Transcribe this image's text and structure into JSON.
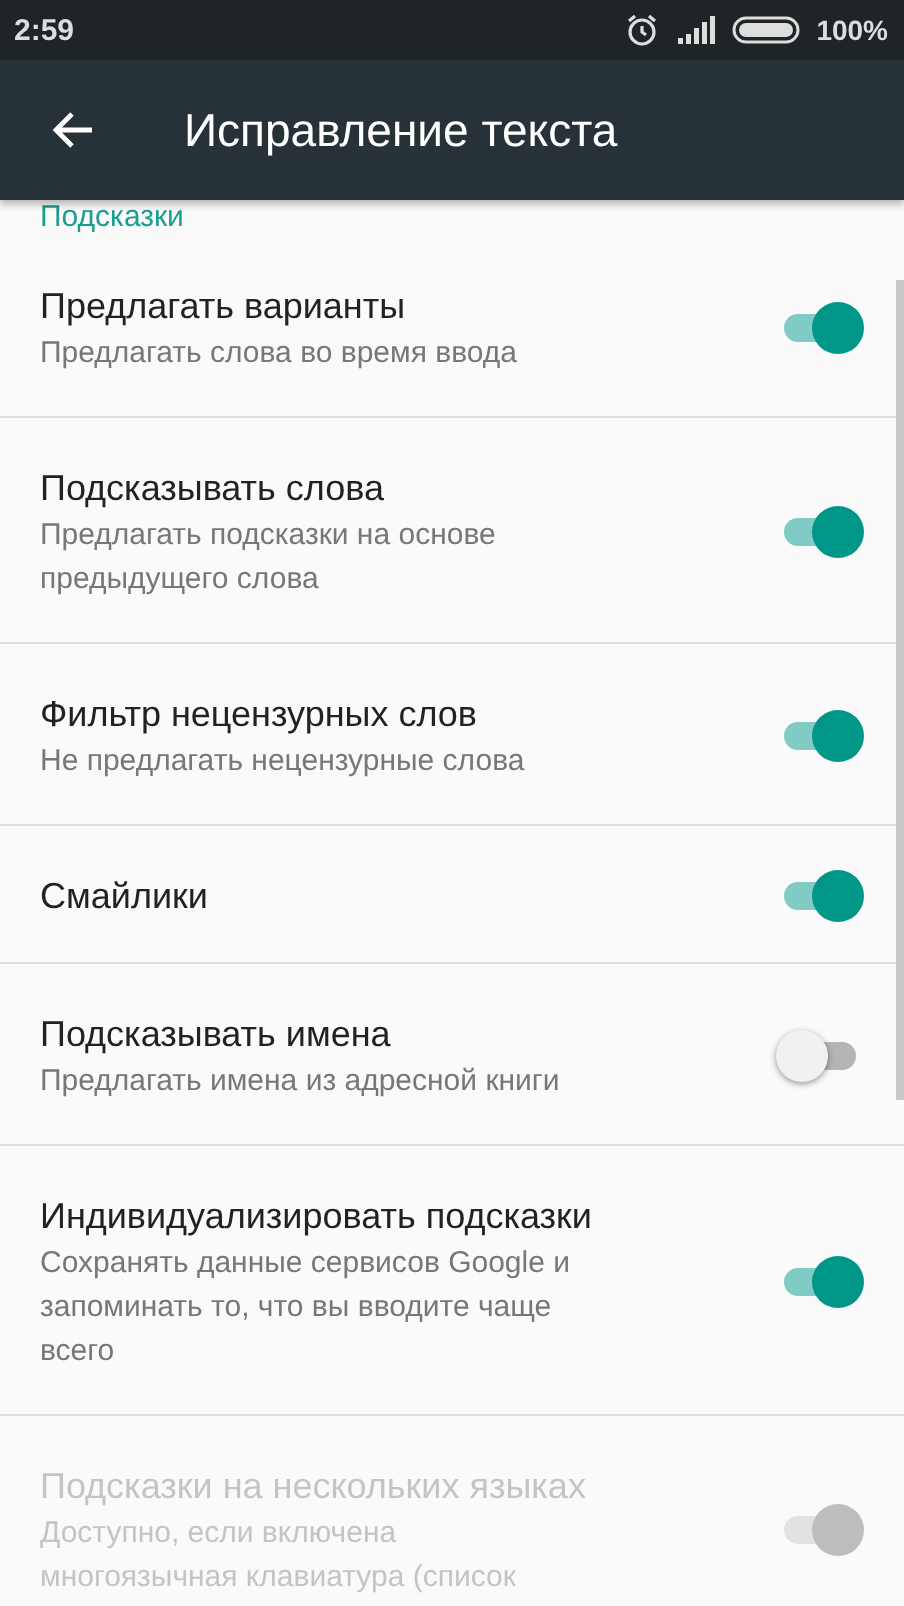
{
  "status_bar": {
    "time": "2:59",
    "battery": "100%"
  },
  "app_bar": {
    "title": "Исправление текста"
  },
  "section": {
    "title": "Подсказки"
  },
  "settings": [
    {
      "title": "Предлагать варианты",
      "summary": [
        "Предлагать слова во время ввода"
      ],
      "on": true,
      "disabled": false
    },
    {
      "title": "Подсказывать слова",
      "summary": [
        "Предлагать подсказки на основе",
        "предыдущего слова"
      ],
      "on": true,
      "disabled": false
    },
    {
      "title": "Фильтр нецензурных слов",
      "summary": [
        "Не предлагать нецензурные слова"
      ],
      "on": true,
      "disabled": false
    },
    {
      "title": "Смайлики",
      "on": true,
      "disabled": false
    },
    {
      "title": "Подсказывать имена",
      "summary": [
        "Предлагать имена из адресной книги"
      ],
      "on": false,
      "disabled": false
    },
    {
      "title": "Индивидуализировать подсказки",
      "summary": [
        "Сохранять данные сервисов Google и",
        "запоминать то, что вы вводите чаще",
        "всего"
      ],
      "on": true,
      "disabled": false
    },
    {
      "title": "Подсказки на нескольких языках",
      "summary": [
        "Доступно, если включена",
        "многоязычная клавиатура (список"
      ],
      "on": true,
      "disabled": true
    }
  ]
}
